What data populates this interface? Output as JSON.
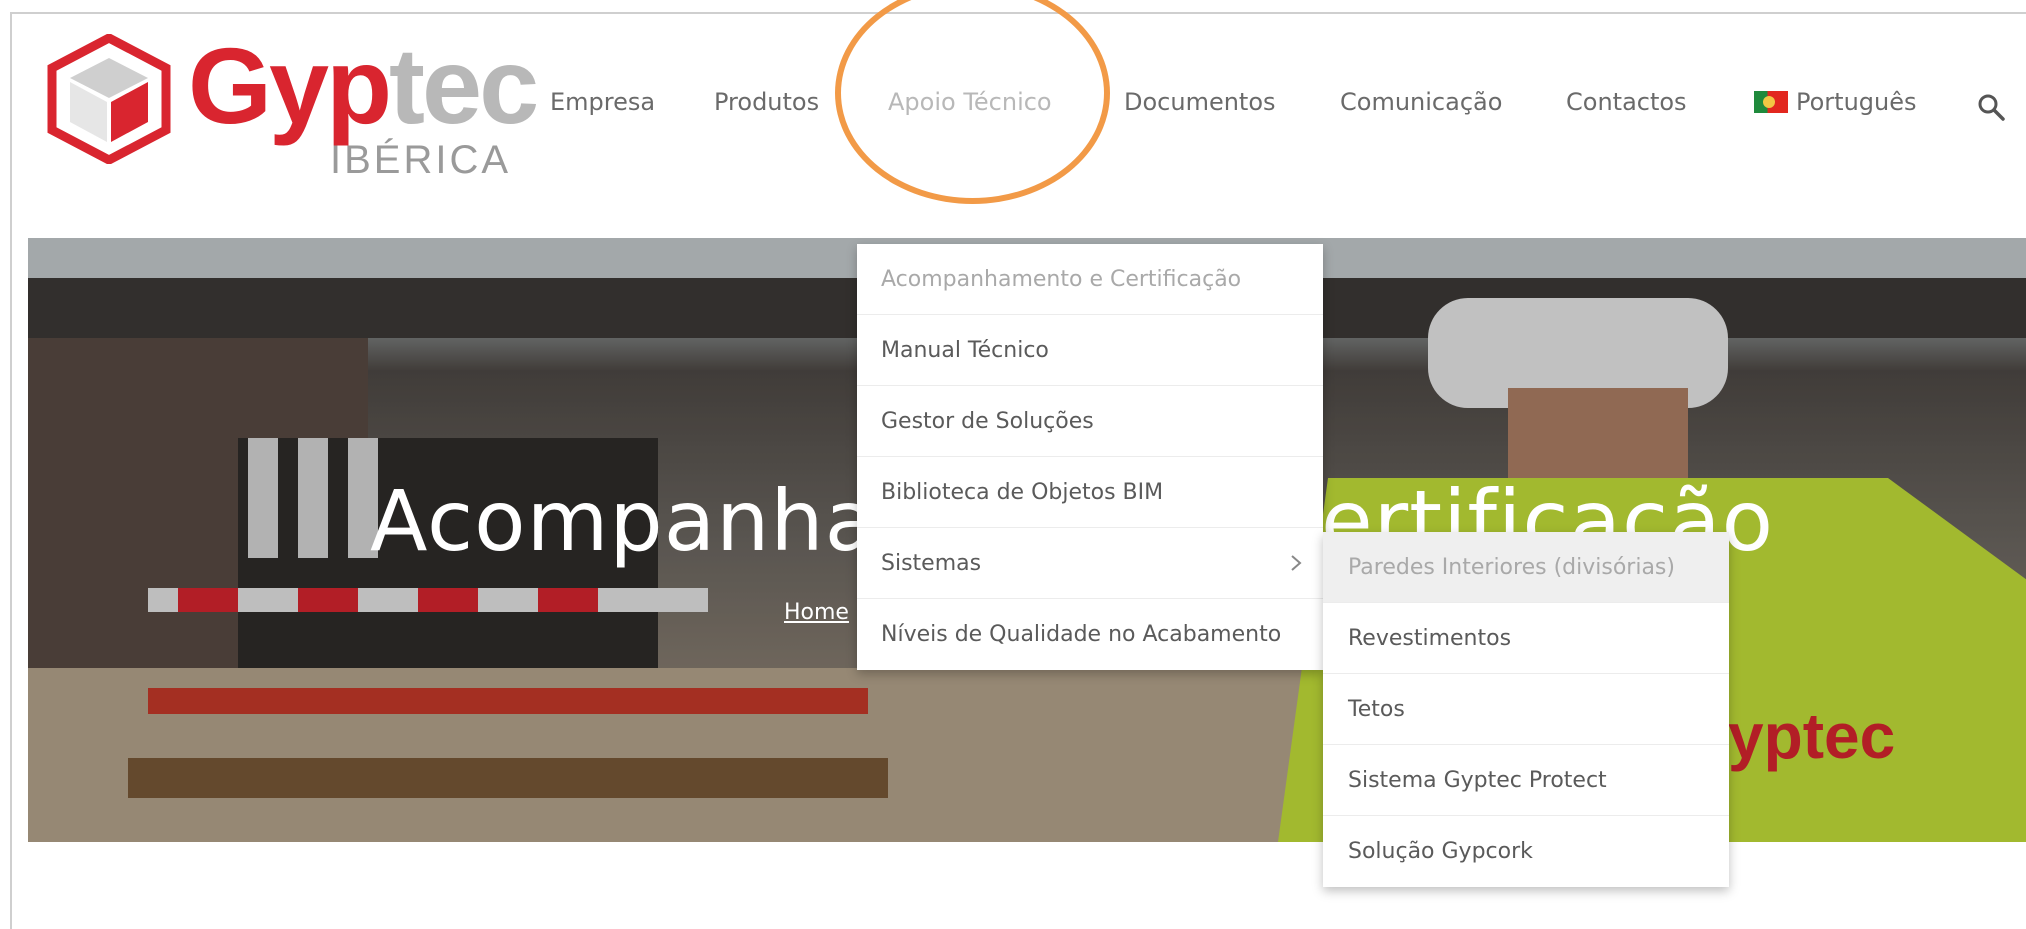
{
  "logo": {
    "word_red": "Gyp",
    "word_grey": "tec",
    "sub": "IBÉRICA"
  },
  "nav": [
    {
      "label": "Empresa"
    },
    {
      "label": "Produtos"
    },
    {
      "label": "Apoio Técnico"
    },
    {
      "label": "Documentos"
    },
    {
      "label": "Comunicação"
    },
    {
      "label": "Contactos"
    },
    {
      "label": "Português"
    }
  ],
  "hero": {
    "title": "Acompanhamento e Certificação",
    "breadcrumb": "Home"
  },
  "dropdown": [
    {
      "label": "Acompanhamento e Certificação"
    },
    {
      "label": "Manual Técnico"
    },
    {
      "label": "Gestor de Soluções"
    },
    {
      "label": "Biblioteca de Objetos BIM"
    },
    {
      "label": "Sistemas"
    },
    {
      "label": "Níveis de Qualidade no Acabamento"
    }
  ],
  "submenu": [
    {
      "label": "Paredes Interiores (divisórias)"
    },
    {
      "label": "Revestimentos"
    },
    {
      "label": "Tetos"
    },
    {
      "label": "Sistema Gyptec Protect"
    },
    {
      "label": "Solução Gypcork"
    }
  ],
  "colors": {
    "brand_red": "#d9252f",
    "highlight_orange": "#f29a47",
    "muted_grey": "#b8b8b8"
  },
  "icons": {
    "search": "search-icon",
    "chevron": "chevron-right-icon",
    "flag": "portugal-flag-icon"
  }
}
